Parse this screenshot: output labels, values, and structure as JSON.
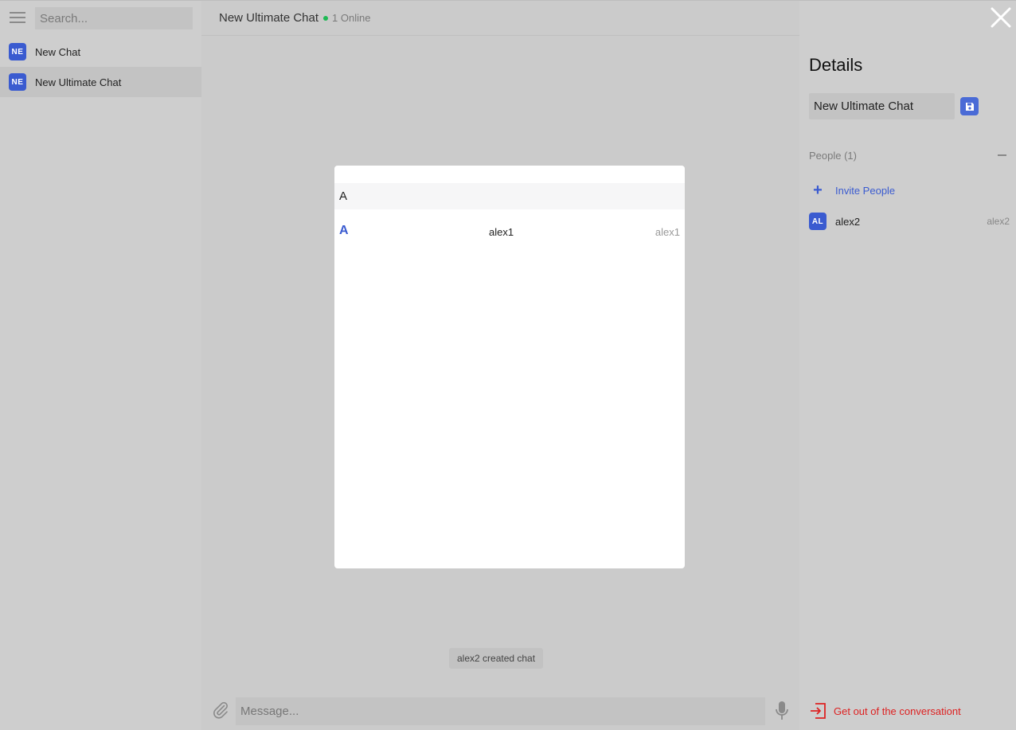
{
  "sidebar": {
    "search_placeholder": "Search...",
    "chats": [
      {
        "avatar": "NE",
        "label": "New Chat",
        "active": false
      },
      {
        "avatar": "NE",
        "label": "New Ultimate Chat",
        "active": true
      }
    ]
  },
  "header": {
    "title": "New Ultimate Chat",
    "online": "1 Online"
  },
  "conversation": {
    "system_message": "alex2 created chat"
  },
  "composer": {
    "placeholder": "Message..."
  },
  "details": {
    "title": "Details",
    "chat_name_value": "New Ultimate Chat",
    "people_label": "People (1)",
    "invite_label": "Invite People",
    "members": [
      {
        "avatar": "AL",
        "name": "alex2",
        "handle": "alex2"
      }
    ],
    "leave_label": "Get out of the conversationt"
  },
  "modal": {
    "search_value": "A",
    "results": [
      {
        "letter": "A",
        "name": "alex1",
        "handle": "alex1"
      }
    ]
  },
  "colors": {
    "accent": "#3a5bd0",
    "online": "#1db954",
    "danger": "#dd2222"
  }
}
